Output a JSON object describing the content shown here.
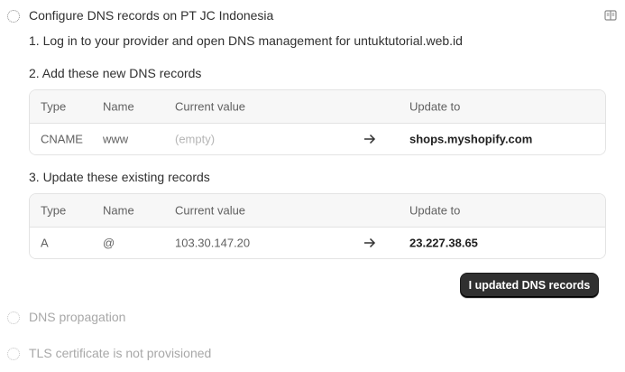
{
  "steps": [
    {
      "title": "Configure DNS records on PT JC Indonesia"
    },
    {
      "title": "DNS propagation"
    },
    {
      "title": "TLS certificate is not provisioned"
    }
  ],
  "instructions": {
    "step1": "1. Log in to your provider and open DNS management for untuktutorial.web.id",
    "step2": "2. Add these new DNS records",
    "step3": "3. Update these existing records"
  },
  "table_headers": {
    "type": "Type",
    "name": "Name",
    "current": "Current value",
    "update": "Update to"
  },
  "new_records": [
    {
      "type": "CNAME",
      "name": "www",
      "current": "(empty)",
      "update": "shops.myshopify.com"
    }
  ],
  "existing_records": [
    {
      "type": "A",
      "name": "@",
      "current": "103.30.147.20",
      "update": "23.227.38.65"
    }
  ],
  "button": {
    "label": "I updated DNS records"
  },
  "icons": {
    "step": "dotted-circle-icon",
    "guide": "book-icon",
    "arrow": "arrow-right-icon"
  }
}
